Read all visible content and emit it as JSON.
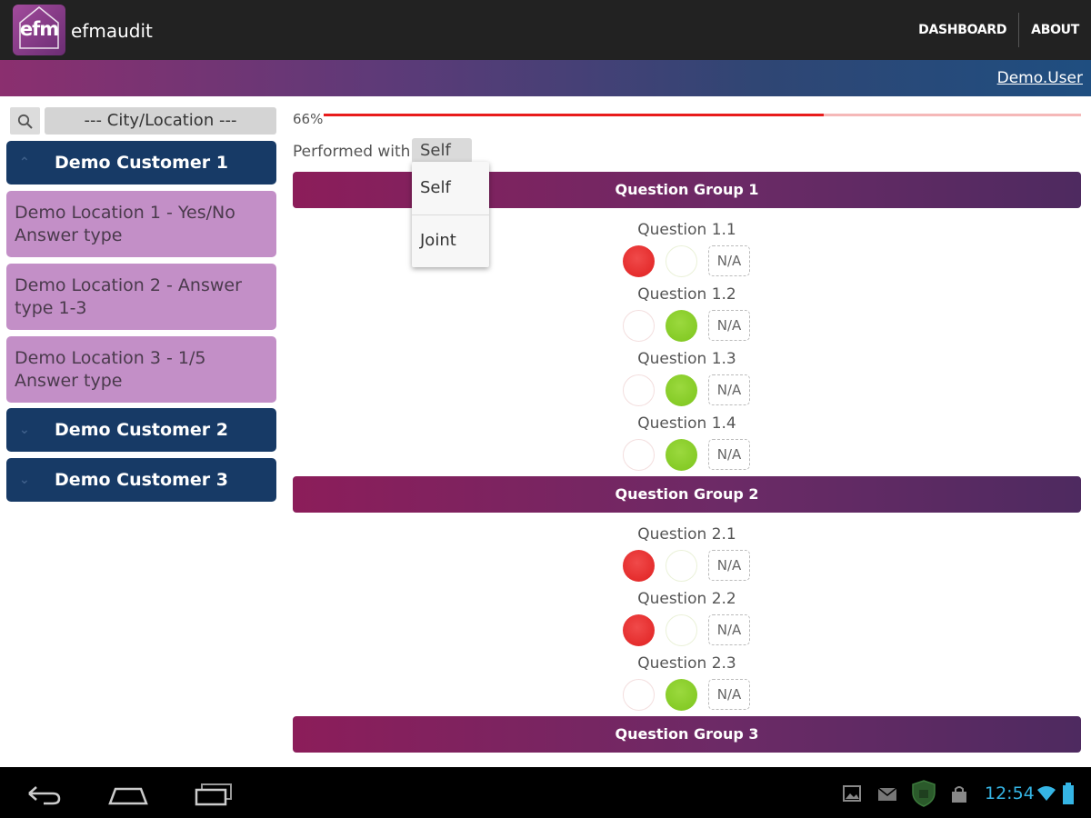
{
  "app": {
    "logo_text": "efm",
    "title": "efmaudit"
  },
  "nav": {
    "dashboard": "DASHBOARD",
    "about": "ABOUT"
  },
  "user": {
    "name": "Demo.User"
  },
  "sidebar": {
    "city_filter": "--- City/Location ---",
    "customers": [
      {
        "label": "Demo Customer 1",
        "expanded": true
      },
      {
        "label": "Demo Customer 2",
        "expanded": false
      },
      {
        "label": "Demo Customer 3",
        "expanded": false
      }
    ],
    "locations": [
      "Demo Location 1 - Yes/No Answer type",
      "Demo Location 2 - Answer type 1-3",
      "Demo Location 3 - 1/5 Answer type"
    ]
  },
  "audit": {
    "progress_label": "66%",
    "progress_value": 0.66,
    "performed_with_label": "Performed with:",
    "performed_with_value": "Self",
    "performed_with_options": [
      "Self",
      "Joint"
    ],
    "na_label": "N/A",
    "groups": [
      {
        "title": "Question Group 1",
        "questions": [
          {
            "label": "Question 1.1",
            "answer": "no"
          },
          {
            "label": "Question 1.2",
            "answer": "yes"
          },
          {
            "label": "Question 1.3",
            "answer": "yes"
          },
          {
            "label": "Question 1.4",
            "answer": "yes"
          }
        ]
      },
      {
        "title": "Question Group 2",
        "questions": [
          {
            "label": "Question 2.1",
            "answer": "no"
          },
          {
            "label": "Question 2.2",
            "answer": "no"
          },
          {
            "label": "Question 2.3",
            "answer": "yes"
          }
        ]
      },
      {
        "title": "Question Group 3",
        "questions": []
      }
    ]
  },
  "system": {
    "clock": "12:54"
  },
  "colors": {
    "accent_purple": "#8c1d5a",
    "customer_navy": "#173a66",
    "location_lilac": "#c38fc7",
    "answer_red": "#e53030",
    "answer_green": "#8ccf2c",
    "progress_red": "#e81c1c",
    "clock_blue": "#35b5e5"
  },
  "icons": {
    "search": "search-icon",
    "back": "back-icon",
    "home": "home-icon",
    "recents": "recent-apps-icon",
    "gallery": "gallery-notification-icon",
    "mail": "mail-notification-icon",
    "shield": "shield-notification-icon",
    "store": "store-notification-icon",
    "wifi": "wifi-icon",
    "battery": "battery-icon"
  }
}
